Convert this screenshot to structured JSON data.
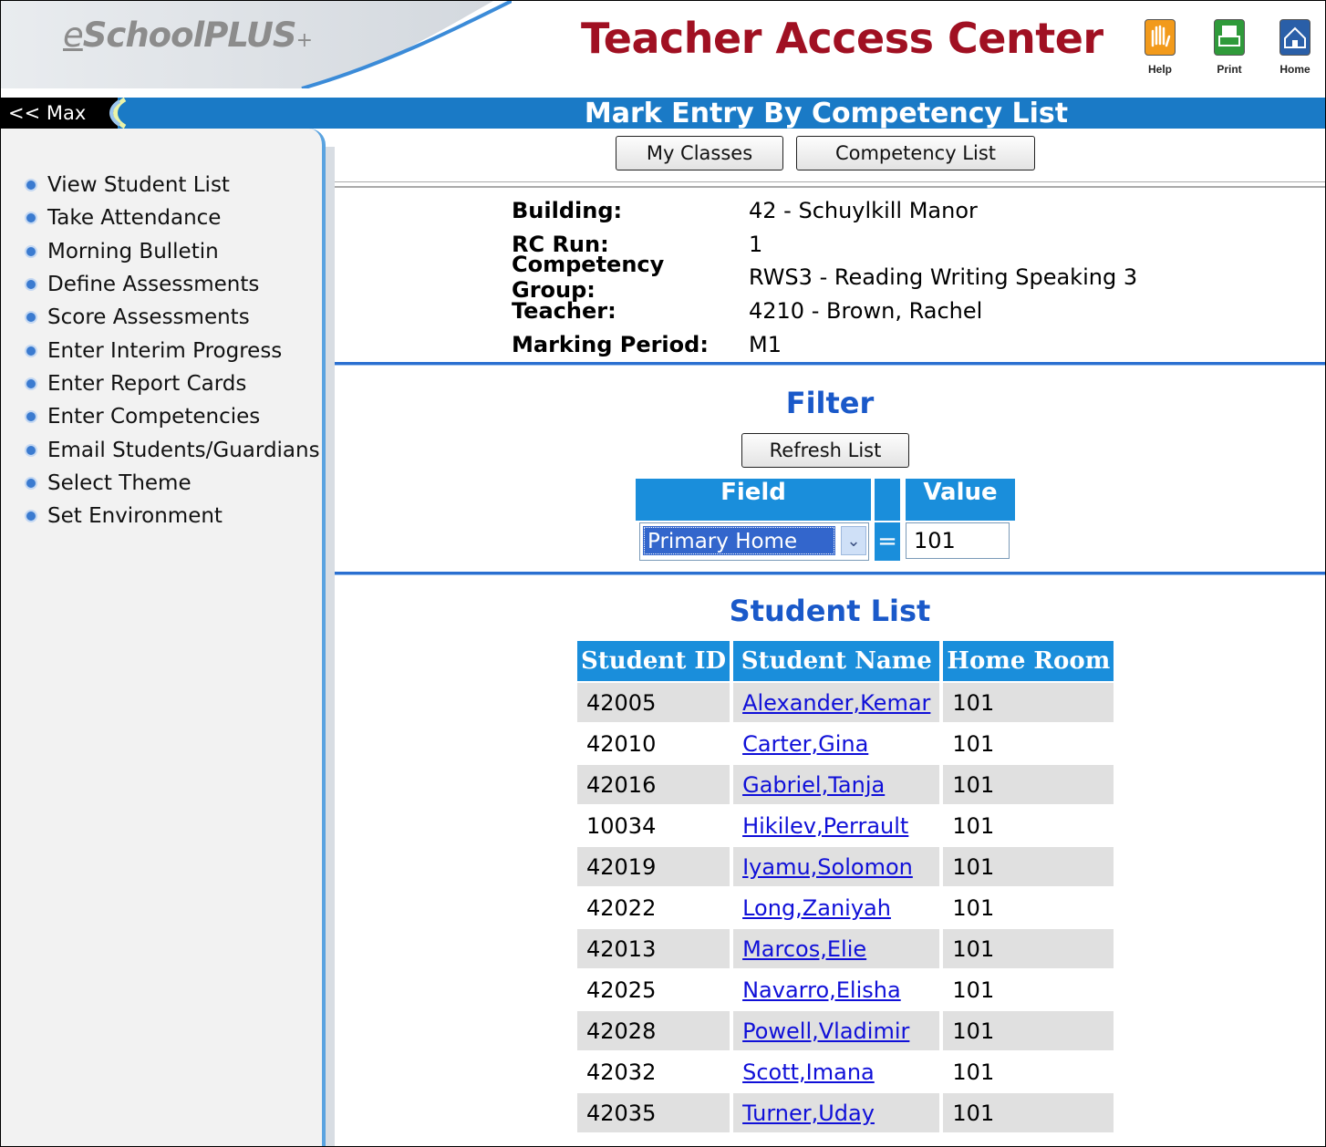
{
  "header": {
    "logo": {
      "e": "e",
      "main": "SchoolPLUS",
      "plus": "+"
    },
    "title": "Teacher Access Center",
    "icons": [
      {
        "name": "help",
        "label": "Help",
        "color": "#f29a1b"
      },
      {
        "name": "print",
        "label": "Print",
        "color": "#2f9a3a"
      },
      {
        "name": "home",
        "label": "Home",
        "color": "#2a5fa8"
      }
    ]
  },
  "bar": {
    "max_label": "<< Max",
    "page_title": "Mark Entry By Competency List"
  },
  "sidebar": {
    "items": [
      "View Student List",
      "Take Attendance",
      "Morning Bulletin",
      "Define Assessments",
      "Score Assessments",
      "Enter Interim Progress",
      "Enter Report Cards",
      "Enter Competencies",
      "Email Students/Guardians",
      "Select Theme",
      "Set Environment"
    ]
  },
  "buttons": {
    "my_classes": "My Classes",
    "competency_list": "Competency List",
    "refresh": "Refresh List"
  },
  "info": [
    {
      "label": "Building:",
      "value": "42 - Schuylkill Manor"
    },
    {
      "label": "RC Run:",
      "value": "1"
    },
    {
      "label": "Competency Group:",
      "value": "RWS3 - Reading Writing Speaking 3"
    },
    {
      "label": "Teacher:",
      "value": "4210 - Brown, Rachel"
    },
    {
      "label": "Marking Period:",
      "value": "M1"
    }
  ],
  "filter": {
    "title": "Filter",
    "field_header": "Field",
    "value_header": "Value",
    "field_selected": "Primary Home",
    "operator": "=",
    "value": "101"
  },
  "student_list": {
    "title": "Student List",
    "columns": [
      "Student ID",
      "Student Name",
      "Home Room"
    ],
    "rows": [
      [
        "42005",
        "Alexander,Kemar",
        "101"
      ],
      [
        "42010",
        "Carter,Gina",
        "101"
      ],
      [
        "42016",
        "Gabriel,Tanja",
        "101"
      ],
      [
        "10034",
        "Hikilev,Perrault",
        "101"
      ],
      [
        "42019",
        "Iyamu,Solomon",
        "101"
      ],
      [
        "42022",
        "Long,Zaniyah",
        "101"
      ],
      [
        "42013",
        "Marcos,Elie",
        "101"
      ],
      [
        "42025",
        "Navarro,Elisha",
        "101"
      ],
      [
        "42028",
        "Powell,Vladimir",
        "101"
      ],
      [
        "42032",
        "Scott,Imana",
        "101"
      ],
      [
        "42035",
        "Turner,Uday",
        "101"
      ]
    ]
  }
}
